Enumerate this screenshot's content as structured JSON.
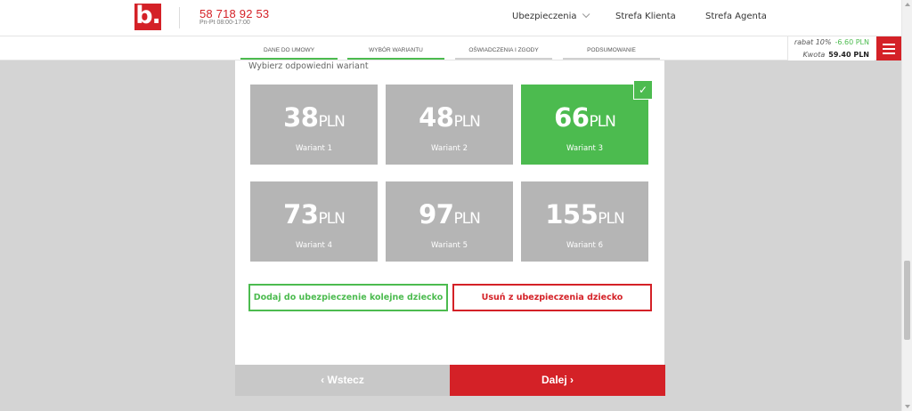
{
  "header": {
    "logo_text": "b.",
    "phone": "58 718 92 53",
    "hours": "Pn-Pt 08:00-17:00",
    "nav": [
      {
        "label": "Ubezpieczenia",
        "icon": "chevron-down-icon"
      },
      {
        "label": "Strefa Klienta"
      },
      {
        "label": "Strefa Agenta"
      }
    ]
  },
  "steps": [
    {
      "label": "DANE DO UMOWY",
      "active": true
    },
    {
      "label": "WYBÓR WARIANTU",
      "active": true
    },
    {
      "label": "OŚWIADCZENIA I ZGODY",
      "active": false
    },
    {
      "label": "PODSUMOWANIE",
      "active": false
    }
  ],
  "summary": {
    "discount_label": "rabat 10%",
    "discount_value": "-6.60 PLN",
    "total_label": "Kwota",
    "total_value": "59.40 PLN"
  },
  "variants": {
    "title": "Wybierz odpowiedni wariant",
    "currency": "PLN",
    "selected_index": 2,
    "items": [
      {
        "amount": "38",
        "name": "Wariant 1"
      },
      {
        "amount": "48",
        "name": "Wariant 2"
      },
      {
        "amount": "66",
        "name": "Wariant 3"
      },
      {
        "amount": "73",
        "name": "Wariant 4"
      },
      {
        "amount": "97",
        "name": "Wariant 5"
      },
      {
        "amount": "155",
        "name": "Wariant 6"
      }
    ],
    "check_glyph": "✓"
  },
  "actions": {
    "add_child": "Dodaj do ubezpieczenie kolejne dziecko",
    "remove_child": "Usuń z ubezpieczenia dziecko",
    "back": "‹ Wstecz",
    "next": "Dalej ›"
  },
  "colors": {
    "brand_red": "#d42127",
    "accent_green": "#4cbb4f",
    "tile_gray": "#b5b5b5"
  }
}
